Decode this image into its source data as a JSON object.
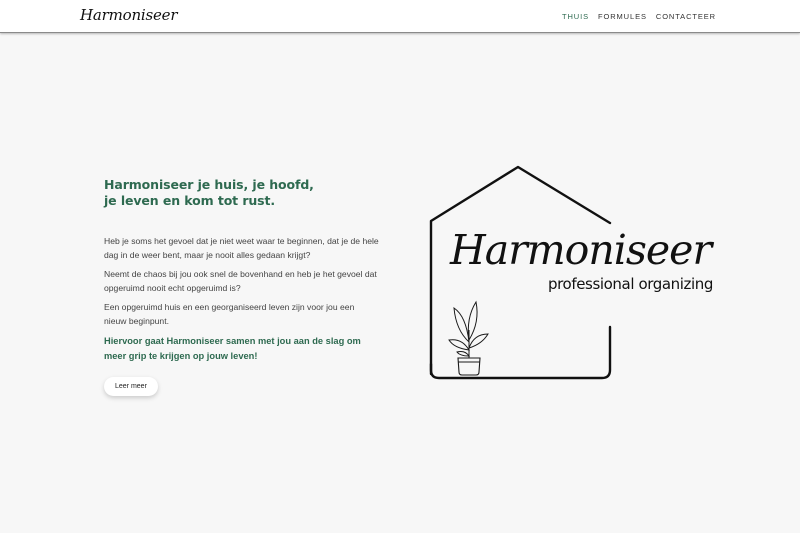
{
  "brand": {
    "name": "Harmoniseer"
  },
  "nav": {
    "items": [
      {
        "label": "THUIS",
        "active": true
      },
      {
        "label": "FORMULES",
        "active": false
      },
      {
        "label": "CONTACTEER",
        "active": false
      }
    ]
  },
  "hero": {
    "headline_line1": "Harmoniseer je huis, je hoofd,",
    "headline_line2": "je leven en kom tot rust.",
    "paragraph1": "Heb je soms het gevoel dat je niet weet waar te beginnen, dat je de hele dag in de weer bent, maar je nooit alles gedaan krijgt?",
    "paragraph2": "Neemt de chaos bij jou ook snel de bovenhand en heb je het gevoel dat opgeruimd nooit echt opgeruimd is?",
    "paragraph3": "Een opgeruimd huis en een georganiseerd leven zijn voor jou een nieuw beginpunt.",
    "highlight": "Hiervoor gaat Harmoniseer samen met jou aan de slag om meer grip te krijgen op jouw leven!",
    "button_label": "Leer meer"
  },
  "logo": {
    "name": "Harmoniseer",
    "tagline": "professional organizing",
    "icons": [
      "house-outline-icon",
      "plant-pot-icon"
    ]
  },
  "colors": {
    "accent": "#2e6a50",
    "background": "#f7f7f7",
    "navbar": "#ffffff",
    "text": "#444444"
  }
}
